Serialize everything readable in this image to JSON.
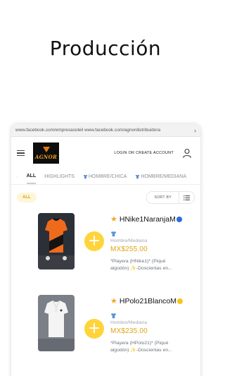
{
  "page_title": "Producción",
  "browser": {
    "url": "www.facebook.com/empresasoleil www.facebook.com/agnordistribuidora",
    "scroll_icon": "chevron-right-icon"
  },
  "header": {
    "logo_text": "AGNOR",
    "login_label": "LOGIN OR CREATE ACCOUNT"
  },
  "tabs": [
    {
      "label": "ALL",
      "active": true
    },
    {
      "label": "HIGHLIGHTS",
      "active": false
    },
    {
      "label": "HOMBRE/CHICA",
      "icon": "shirt-icon",
      "active": false
    },
    {
      "label": "HOMBRE/MEDIANA",
      "icon": "shirt-icon",
      "active": false
    }
  ],
  "filter": {
    "chip": "ALL",
    "sort_label": "SORT BY"
  },
  "products": [
    {
      "name": "HNike1NaranjaM",
      "dot_color": "#2d6cdf",
      "category": "Hombre/Mediana",
      "price": "MX$255.00",
      "description_line1": "*Playera (HNike1)* (Piqué",
      "description_line2": "algodón) ✨-Doscientas en...",
      "image": "orange-black polo shirt on mannequin"
    },
    {
      "name": "HPolo21BlancoM",
      "dot_color": "#f2c61f",
      "category": "Hombre/Mediana",
      "price": "MX$235.00",
      "description_line1": "*Playera (HPolo21)* (Piqué",
      "description_line2": "algodón) ✨-Doscientas en...",
      "image": "white polo shirt on mannequin"
    }
  ],
  "colors": {
    "accent": "#ffd43a",
    "price": "#e0a514"
  }
}
